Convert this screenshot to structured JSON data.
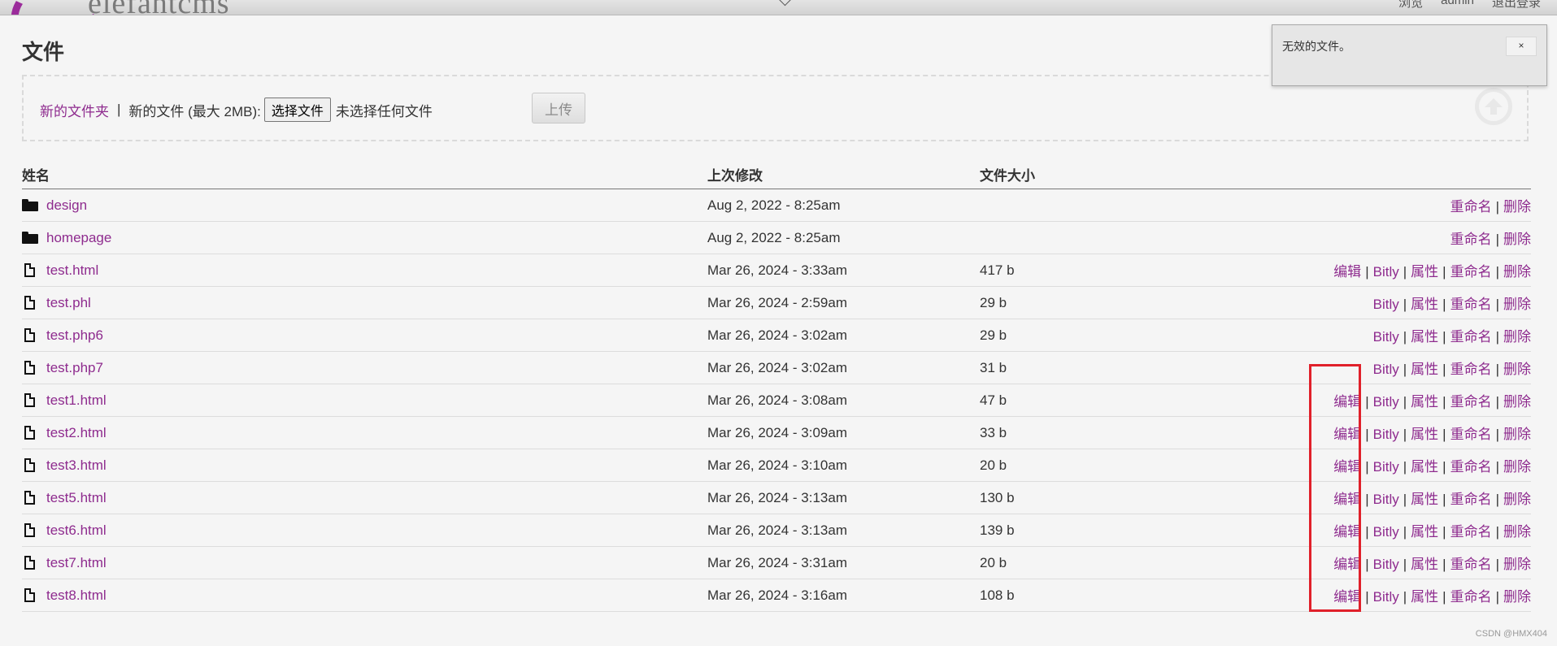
{
  "header": {
    "logo": "elefantcms",
    "user_links": [
      "浏览",
      "admin",
      "退出登录"
    ]
  },
  "page": {
    "title": "文件"
  },
  "upload": {
    "new_folder_label": "新的文件夹",
    "separator": "|",
    "new_file_label": "新的文件 (最大 2MB):",
    "choose_file_label": "选择文件",
    "no_file_label": "未选择任何文件",
    "upload_button": "上传"
  },
  "table": {
    "headers": {
      "name": "姓名",
      "modified": "上次修改",
      "size": "文件大小"
    },
    "rows": [
      {
        "type": "folder",
        "name": "design",
        "modified": "Aug 2, 2022 - 8:25am",
        "size": "",
        "actions": [
          "重命名",
          "删除"
        ]
      },
      {
        "type": "folder",
        "name": "homepage",
        "modified": "Aug 2, 2022 - 8:25am",
        "size": "",
        "actions": [
          "重命名",
          "删除"
        ]
      },
      {
        "type": "file",
        "name": "test.html",
        "modified": "Mar 26, 2024 - 3:33am",
        "size": "417 b",
        "actions": [
          "编辑",
          "Bitly",
          "属性",
          "重命名",
          "删除"
        ]
      },
      {
        "type": "file",
        "name": "test.phl",
        "modified": "Mar 26, 2024 - 2:59am",
        "size": "29 b",
        "actions": [
          "Bitly",
          "属性",
          "重命名",
          "删除"
        ]
      },
      {
        "type": "file",
        "name": "test.php6",
        "modified": "Mar 26, 2024 - 3:02am",
        "size": "29 b",
        "actions": [
          "Bitly",
          "属性",
          "重命名",
          "删除"
        ]
      },
      {
        "type": "file",
        "name": "test.php7",
        "modified": "Mar 26, 2024 - 3:02am",
        "size": "31 b",
        "actions": [
          "Bitly",
          "属性",
          "重命名",
          "删除"
        ]
      },
      {
        "type": "file",
        "name": "test1.html",
        "modified": "Mar 26, 2024 - 3:08am",
        "size": "47 b",
        "actions": [
          "编辑",
          "Bitly",
          "属性",
          "重命名",
          "删除"
        ]
      },
      {
        "type": "file",
        "name": "test2.html",
        "modified": "Mar 26, 2024 - 3:09am",
        "size": "33 b",
        "actions": [
          "编辑",
          "Bitly",
          "属性",
          "重命名",
          "删除"
        ]
      },
      {
        "type": "file",
        "name": "test3.html",
        "modified": "Mar 26, 2024 - 3:10am",
        "size": "20 b",
        "actions": [
          "编辑",
          "Bitly",
          "属性",
          "重命名",
          "删除"
        ]
      },
      {
        "type": "file",
        "name": "test5.html",
        "modified": "Mar 26, 2024 - 3:13am",
        "size": "130 b",
        "actions": [
          "编辑",
          "Bitly",
          "属性",
          "重命名",
          "删除"
        ]
      },
      {
        "type": "file",
        "name": "test6.html",
        "modified": "Mar 26, 2024 - 3:13am",
        "size": "139 b",
        "actions": [
          "编辑",
          "Bitly",
          "属性",
          "重命名",
          "删除"
        ]
      },
      {
        "type": "file",
        "name": "test7.html",
        "modified": "Mar 26, 2024 - 3:31am",
        "size": "20 b",
        "actions": [
          "编辑",
          "Bitly",
          "属性",
          "重命名",
          "删除"
        ]
      },
      {
        "type": "file",
        "name": "test8.html",
        "modified": "Mar 26, 2024 - 3:16am",
        "size": "108 b",
        "actions": [
          "编辑",
          "Bitly",
          "属性",
          "重命名",
          "删除"
        ]
      }
    ]
  },
  "notification": {
    "message": "无效的文件。",
    "close_label": "×"
  },
  "watermark": "CSDN @HMX404",
  "colors": {
    "link": "#8e2b8e",
    "highlight_box": "#e0202a",
    "background": "#f5f5f5"
  }
}
